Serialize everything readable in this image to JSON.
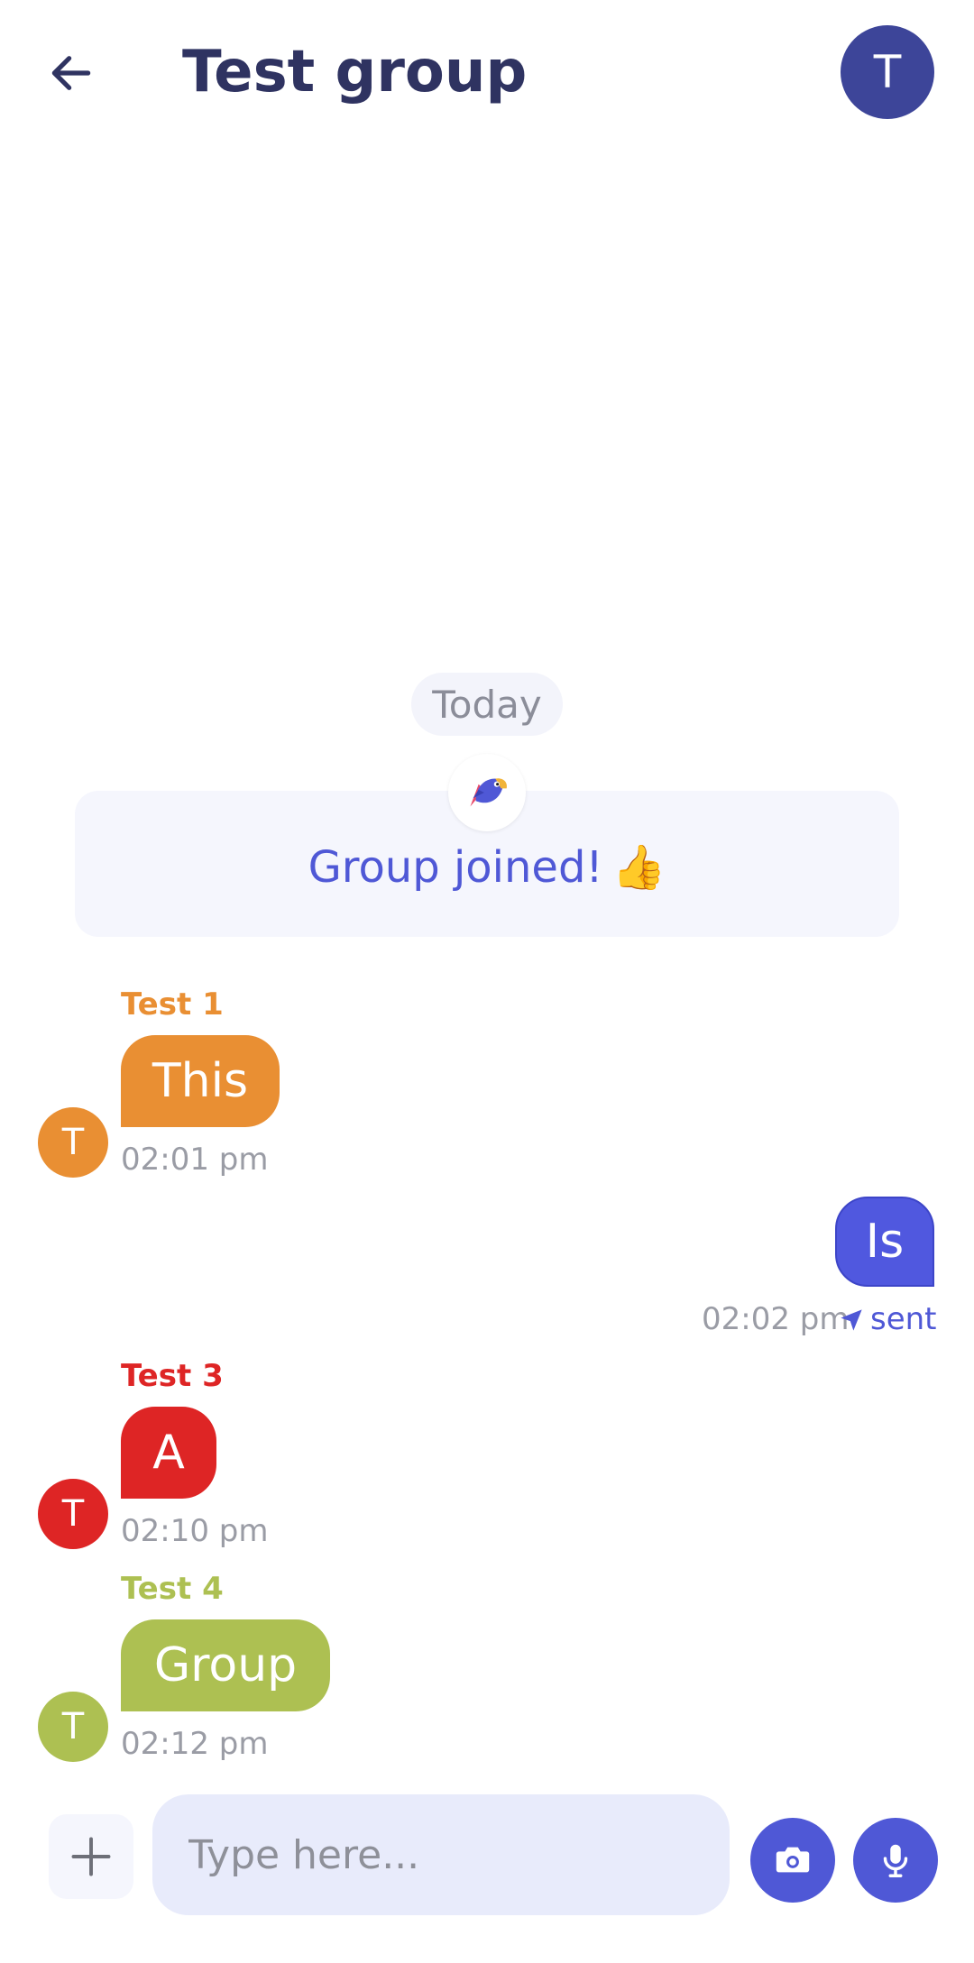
{
  "header": {
    "title": "Test group",
    "avatar_initial": "T"
  },
  "date_divider": "Today",
  "system_message": {
    "text": "Group joined!",
    "emoji": "👍"
  },
  "messages": [
    {
      "sender": "Test 1",
      "text": "This",
      "time": "02:01 pm",
      "avatar_initial": "T",
      "color": "#e98f33"
    },
    {
      "text": "Is",
      "time": "02:02 pm",
      "status": "sent",
      "color": "#5058df"
    },
    {
      "sender": "Test 3",
      "text": "A",
      "time": "02:10 pm",
      "avatar_initial": "T",
      "color": "#de2525"
    },
    {
      "sender": "Test 4",
      "text": "Group",
      "time": "02:12 pm",
      "avatar_initial": "T",
      "color": "#adc052"
    }
  ],
  "composer": {
    "placeholder": "Type here..."
  },
  "icons": {
    "back": "arrow-left-icon",
    "plus": "plus-icon",
    "camera": "camera-icon",
    "mic": "microphone-icon",
    "sent": "send-arrow-icon"
  },
  "colors": {
    "accent": "#4f58d6",
    "title": "#2f3361"
  }
}
